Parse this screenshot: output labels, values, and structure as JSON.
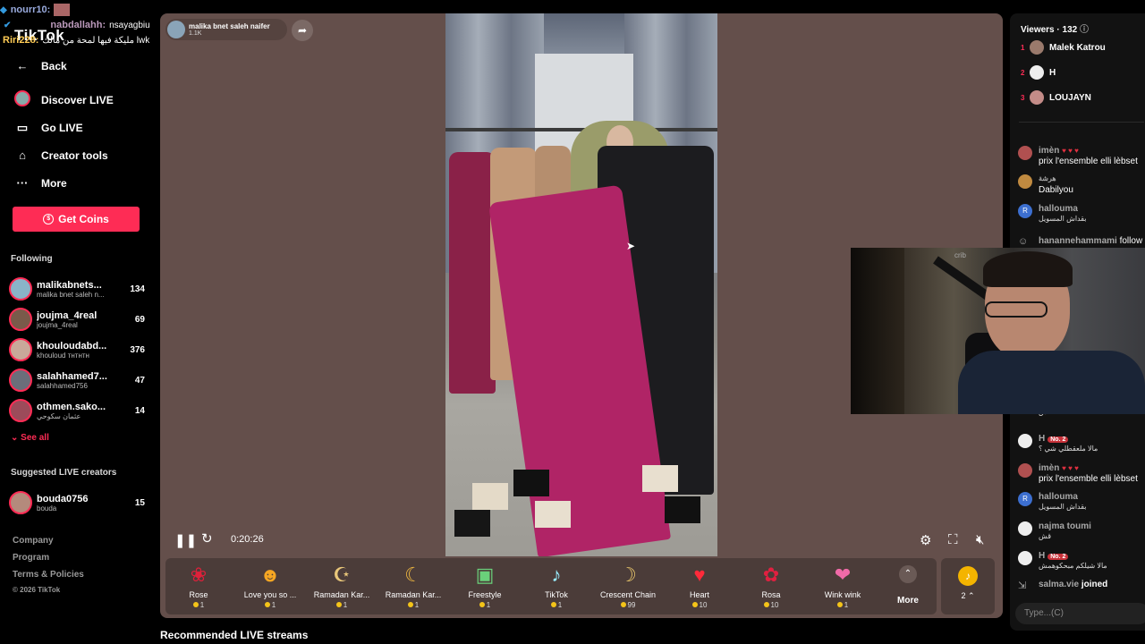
{
  "overlay": {
    "line1_user": "nourr10:",
    "line2_user": "nabdallahh:",
    "line2_text": "nsayagbiu",
    "line3_user": "Riri228:",
    "line3_text": "مليكة فيها لمحة من مالك lwk",
    "logo": "TikTok"
  },
  "sidebar": {
    "back": "Back",
    "nav": [
      {
        "label": "Discover LIVE",
        "icon": "discover-live-icon"
      },
      {
        "label": "Go LIVE",
        "icon": "camera-icon"
      },
      {
        "label": "Creator tools",
        "icon": "home-icon"
      },
      {
        "label": "More",
        "icon": "more-dots-icon"
      }
    ],
    "get_coins": "Get Coins",
    "following_title": "Following",
    "following": [
      {
        "name": "malikabnets...",
        "sub": "malika bnet saleh n...",
        "count": "134"
      },
      {
        "name": "joujma_4real",
        "sub": "joujma_4real",
        "count": "69"
      },
      {
        "name": "khouloudabd...",
        "sub": "khouloud тнтнтн",
        "count": "376"
      },
      {
        "name": "salahhamed7...",
        "sub": "salahhamed756",
        "count": "47"
      },
      {
        "name": "othmen.sako...",
        "sub": "عثمان سكوحي",
        "count": "14"
      }
    ],
    "see_all": "See all",
    "suggested_title": "Suggested LIVE creators",
    "suggested": [
      {
        "name": "bouda0756",
        "sub": "bouda",
        "count": "15"
      }
    ],
    "footer": [
      "Company",
      "Program",
      "Terms & Policies",
      "© 2026 TikTok"
    ]
  },
  "stream": {
    "host_name": "malika bnet saleh naifer",
    "host_likes": "1.1K",
    "time": "0:20:26",
    "gifts": [
      {
        "icon": "rose-icon",
        "label": "Rose",
        "price": "1"
      },
      {
        "icon": "heart-face-icon",
        "label": "Love you so ...",
        "price": "1"
      },
      {
        "icon": "ramadan-icon",
        "label": "Ramadan Kar...",
        "price": "1"
      },
      {
        "icon": "ramadan-card-icon",
        "label": "Ramadan Kar...",
        "price": "1"
      },
      {
        "icon": "freestyle-icon",
        "label": "Freestyle",
        "price": "1"
      },
      {
        "icon": "tiktok-icon",
        "label": "TikTok",
        "price": "1"
      },
      {
        "icon": "crescent-chain-icon",
        "label": "Crescent Chain",
        "price": "99"
      },
      {
        "icon": "heart-icon",
        "label": "Heart",
        "price": "10"
      },
      {
        "icon": "rosa-icon",
        "label": "Rosa",
        "price": "10"
      },
      {
        "icon": "wink-icon",
        "label": "Wink wink",
        "price": "1"
      }
    ],
    "more": "More",
    "music_count": "2",
    "recommended": "Recommended LIVE streams"
  },
  "chat": {
    "viewers_label": "Viewers",
    "viewers_count": "132",
    "top_viewers": [
      {
        "rank": "1",
        "name": "Malek Katrou"
      },
      {
        "rank": "2",
        "name": "H"
      },
      {
        "rank": "3",
        "name": "LOUJAYN"
      }
    ],
    "comments": [
      {
        "user": "imèn",
        "hearts": "♥ ♥ ♥",
        "text": "prix l'ensemble elli lèbset"
      },
      {
        "user": "هرشة",
        "text": "Dabilyou"
      },
      {
        "user": "hallouma",
        "text": "بقداش المسويل"
      },
      {
        "user": "hanannehammami",
        "text": "follow"
      }
    ],
    "comments_bottom": [
      {
        "user": "",
        "text": "قش"
      },
      {
        "user": "H",
        "badge": "No. 2",
        "text": "مالا ملعقطلي شي ؟"
      },
      {
        "user": "imèn",
        "hearts": "♥ ♥ ♥",
        "text": "prix l'ensemble elli lèbset"
      },
      {
        "user": "hallouma",
        "text": "بقداش المسويل"
      },
      {
        "user": "najma toumi",
        "text": "قش"
      },
      {
        "user": "H",
        "badge": "No. 2",
        "text": "مالا شيلكم مبحكوهمش"
      }
    ],
    "joined_user": "salma.vie",
    "joined_text": "joined",
    "input_placeholder": "Type...(C)"
  },
  "webcam": {
    "label": "crib"
  }
}
